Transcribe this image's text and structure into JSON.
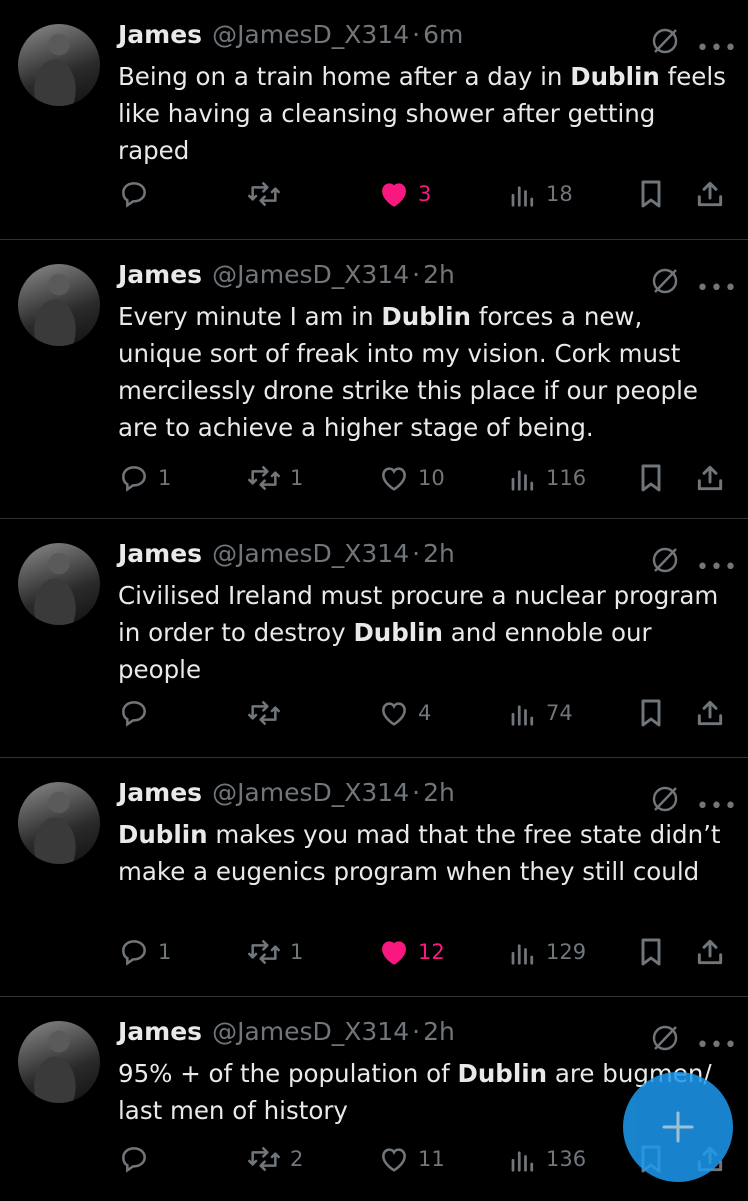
{
  "tweets": [
    {
      "name": "James",
      "handle": "@JamesD_X314",
      "dot": "·",
      "time": "6m",
      "text_parts": [
        "Being on a train home after a day in ",
        "Dublin",
        " feels like having a cleansing shower after getting raped"
      ],
      "replies": "",
      "reposts": "",
      "likes": "3",
      "views": "18",
      "liked": true
    },
    {
      "name": "James",
      "handle": "@JamesD_X314",
      "dot": "·",
      "time": "2h",
      "text_parts": [
        "Every minute I am in ",
        "Dublin",
        " forces a new, unique sort of freak into my vision. Cork must mercilessly drone strike this place if our people are to achieve a higher stage of being."
      ],
      "replies": "1",
      "reposts": "1",
      "likes": "10",
      "views": "116",
      "liked": false
    },
    {
      "name": "James",
      "handle": "@JamesD_X314",
      "dot": "·",
      "time": "2h",
      "text_parts": [
        "Civilised Ireland must procure a nuclear program in order to destroy ",
        "Dublin",
        " and ennoble our people"
      ],
      "replies": "",
      "reposts": "",
      "likes": "4",
      "views": "74",
      "liked": false
    },
    {
      "name": "James",
      "handle": "@JamesD_X314",
      "dot": "·",
      "time": "2h",
      "text_parts": [
        "",
        "Dublin",
        " makes you mad that the free state didn’t make a eugenics program when they still could"
      ],
      "replies": "1",
      "reposts": "1",
      "likes": "12",
      "views": "129",
      "liked": true
    },
    {
      "name": "James",
      "handle": "@JamesD_X314",
      "dot": "·",
      "time": "2h",
      "text_parts": [
        "95% + of the population of ",
        "Dublin",
        " are bugmen/ last men of history"
      ],
      "replies": "",
      "reposts": "2",
      "likes": "11",
      "views": "136",
      "liked": false
    }
  ],
  "icons": {
    "reply": "reply-icon",
    "repost": "repost-icon",
    "like": "heart-icon",
    "views": "views-icon",
    "bookmark": "bookmark-icon",
    "share": "share-icon",
    "grok": "grok-icon",
    "more": "more-icon",
    "compose": "plus-icon"
  },
  "colors": {
    "background": "#000000",
    "text": "#e7e9ea",
    "muted": "#71767b",
    "like": "#f91880",
    "accent": "#1d9bf0",
    "divider": "#2f3336"
  }
}
